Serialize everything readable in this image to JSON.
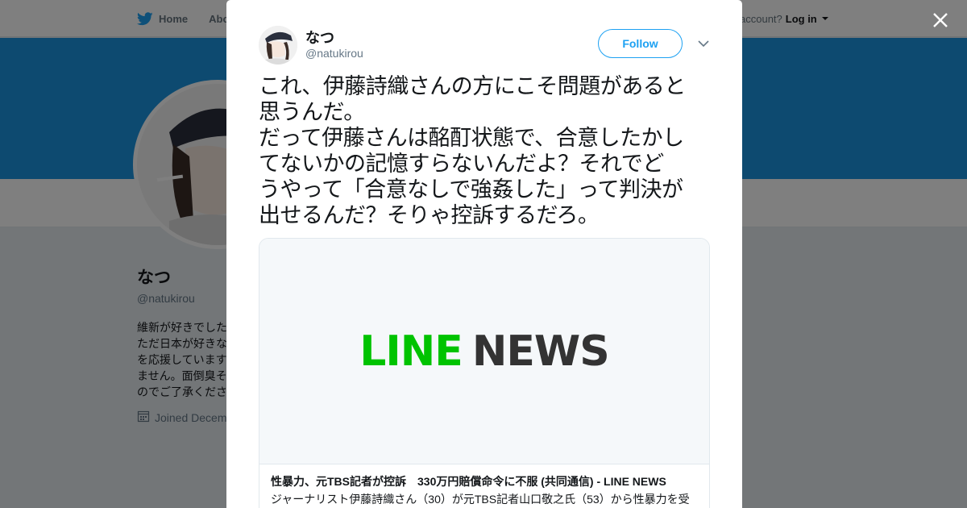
{
  "topnav": {
    "home_label": "Home",
    "about_label": "About",
    "account_prompt": "account?",
    "login_label": "Log in"
  },
  "profile": {
    "name": "なつ",
    "handle": "@natukirou",
    "bio": "維新が好きでした\nただ日本が好きな\nを応援しています\nません。面倒臭そ\nのでご了承くださ",
    "joined": "Joined Decem"
  },
  "tweet": {
    "author_name": "なつ",
    "author_handle": "@natukirou",
    "follow_label": "Follow",
    "text": "これ、伊藤詩織さんの方にこそ問題があると\n思うんだ。\nだって伊藤さんは酩酊状態で、合意したかし\nてないかの記憶すらないんだよ？それでど\nうやって「合意なしで強姦した」って判決が\n出せるんだ？そりゃ控訴するだろ。",
    "card": {
      "logo_line": "LINE",
      "logo_news": "NEWS",
      "title": "性暴力、元TBS記者が控訴　330万円賠償命令に不服 (共同通信) - LINE NEWS",
      "description": "ジャーナリスト伊藤詩織さん（30）が元TBS記者山口敬之氏（53）から性暴力を受"
    }
  },
  "colors": {
    "twitter_blue": "#1da1f2",
    "banner_blue": "#1b95e0",
    "line_green": "#00c300",
    "overlay": "rgba(0,0,0,0.5)"
  },
  "icons": [
    "twitter-bird-icon",
    "calendar-icon",
    "close-icon",
    "chevron-down-icon"
  ]
}
